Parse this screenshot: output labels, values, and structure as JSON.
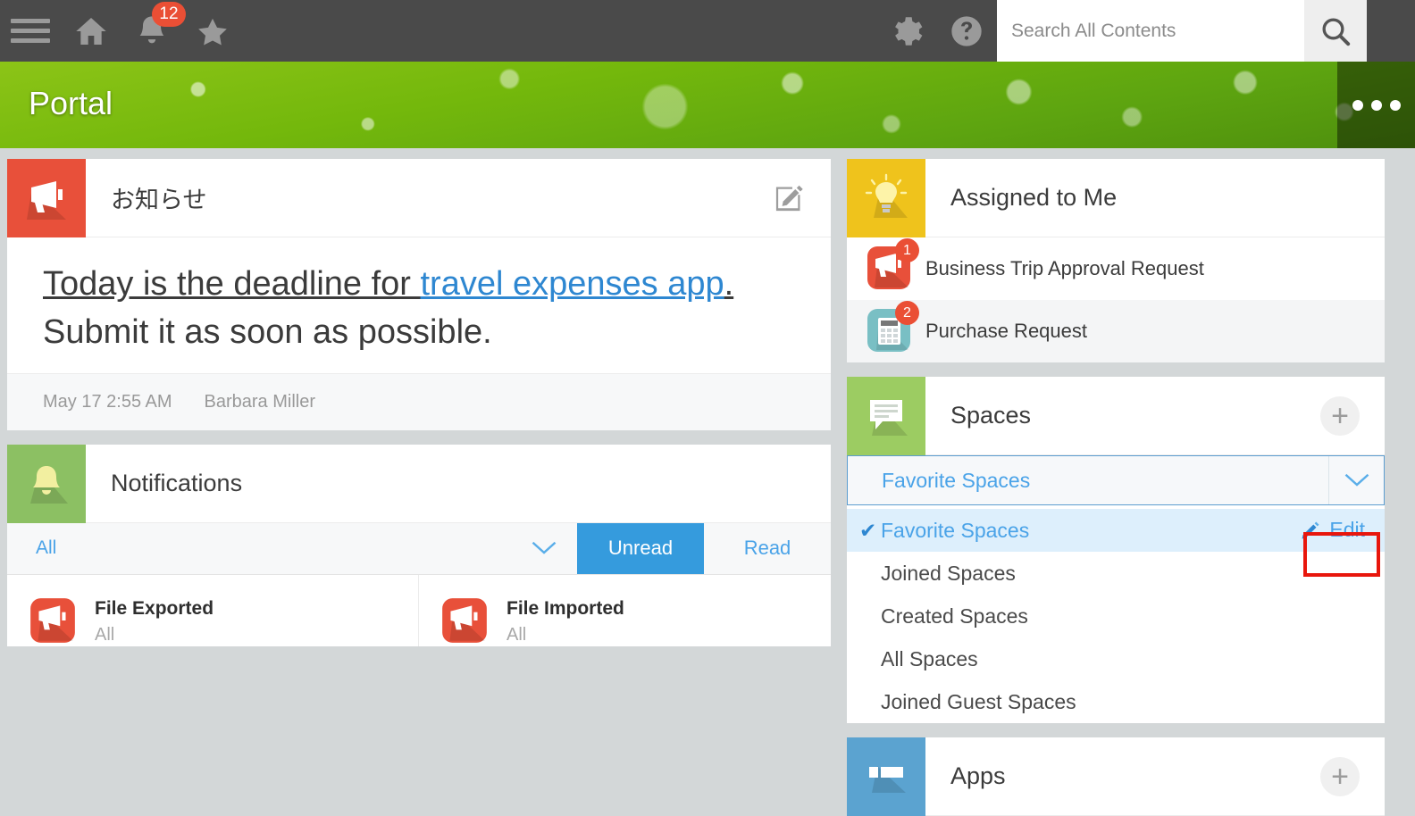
{
  "topbar": {
    "menu_icon": "hamburger-icon",
    "home_icon": "home-icon",
    "bell_icon": "bell-icon",
    "bell_badge": "12",
    "star_icon": "star-icon",
    "gear_icon": "gear-icon",
    "help_icon": "help-icon",
    "search_placeholder": "Search All Contents",
    "search_value": "",
    "search_icon": "magnifier-icon"
  },
  "banner": {
    "title": "Portal",
    "more_icon": "ellipsis-icon"
  },
  "announcements": {
    "icon": "megaphone-icon",
    "title": "お知らせ",
    "compose_icon": "compose-icon",
    "body": {
      "line1_plain": "Today is the deadline for ",
      "line1_link": "travel expenses app",
      "line1_period": ".",
      "line2": "Submit it as soon as possible."
    },
    "timestamp": "May 17 2:55 AM",
    "author": "Barbara Miller"
  },
  "notifications": {
    "icon": "bell-icon",
    "title": "Notifications",
    "filter_label": "All",
    "filter_caret": "chevron-down-icon",
    "tabs": [
      {
        "label": "Unread",
        "active": true
      },
      {
        "label": "Read",
        "active": false
      }
    ],
    "items": [
      {
        "icon": "megaphone-icon",
        "title": "File Exported",
        "subtitle": "All"
      },
      {
        "icon": "megaphone-icon",
        "title": "File Imported",
        "subtitle": "All"
      }
    ]
  },
  "assigned_to_me": {
    "icon": "lightbulb-icon",
    "title": "Assigned to Me",
    "items": [
      {
        "icon": "megaphone-icon",
        "label": "Business Trip Approval Request",
        "badge": "1"
      },
      {
        "icon": "calculator-icon",
        "label": "Purchase Request",
        "badge": "2"
      }
    ]
  },
  "spaces": {
    "icon": "speech-bubble-icon",
    "title": "Spaces",
    "add_icon": "plus-icon",
    "selected": "Favorite Spaces",
    "caret_icon": "chevron-down-icon",
    "dropdown": [
      {
        "label": "Favorite Spaces",
        "selected": true
      },
      {
        "label": "Joined Spaces",
        "selected": false
      },
      {
        "label": "Created Spaces",
        "selected": false
      },
      {
        "label": "All Spaces",
        "selected": false
      },
      {
        "label": "Joined Guest Spaces",
        "selected": false
      }
    ],
    "edit_label": "Edit",
    "edit_icon": "pencil-icon"
  },
  "apps": {
    "icon": "app-window-icon",
    "title": "Apps",
    "add_icon": "plus-icon"
  },
  "colors": {
    "accent_blue": "#4aa3e8",
    "badge_red": "#ea4f35",
    "highlight_red": "#e8160c",
    "topbar_gray": "#4a4a4a",
    "page_bg": "#d3d7d8"
  }
}
